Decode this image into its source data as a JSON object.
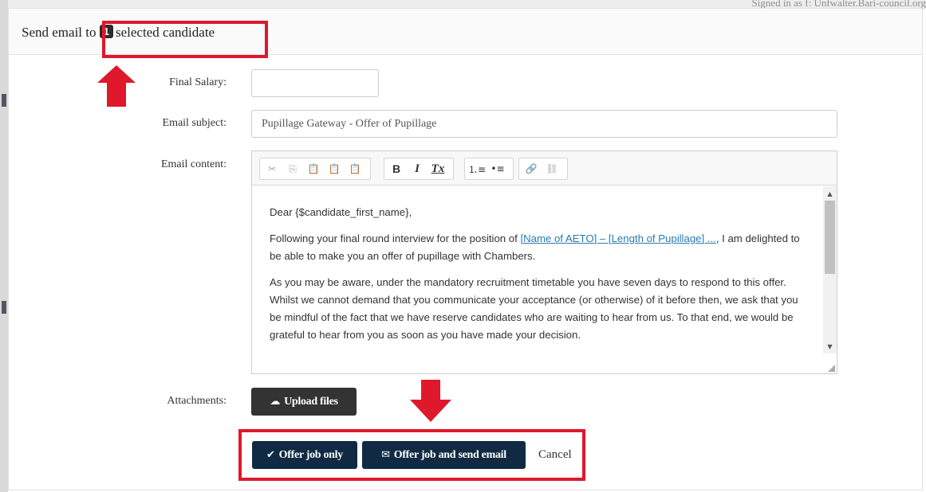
{
  "background": {
    "top_text": "Signed in as f: Unfwalter.Bari-council.org"
  },
  "modal": {
    "title_prefix": "Send email to",
    "selected_count": "1",
    "title_suffix": "selected candidate"
  },
  "form": {
    "final_salary": {
      "label": "Final Salary:",
      "value": ""
    },
    "email_subject": {
      "label": "Email subject:",
      "value": "Pupillage Gateway - Offer of Pupillage"
    },
    "email_content": {
      "label": "Email content:",
      "toolbar": {
        "clipboard": [
          "cut-icon",
          "copy-icon",
          "paste-icon",
          "paste-text-icon",
          "paste-word-icon"
        ],
        "basic": [
          "B",
          "I",
          "Tx"
        ],
        "lists": [
          "numbered-list-icon",
          "bulleted-list-icon"
        ],
        "links": [
          "link-icon",
          "unlink-icon"
        ]
      },
      "greeting": "Dear {$candidate_first_name},",
      "para1_before": "Following your final round interview for the position of ",
      "para1_link": "[Name of AETO] – [Length of Pupillage] ...",
      "para1_after": ", I am delighted to be able to make you an offer of pupillage with Chambers.",
      "para2": "As you may be aware, under the mandatory recruitment timetable you have seven days to respond to this offer. Whilst we cannot demand that you communicate your acceptance (or otherwise) of it before then, we ask that you be mindful of the fact that we have reserve candidates who are waiting to hear from us. To that end, we would be grateful to hear from you as soon as you have made your decision."
    },
    "attachments": {
      "label": "Attachments:",
      "upload_label": "Upload files"
    }
  },
  "actions": {
    "offer_only": "Offer job only",
    "offer_and_email": "Offer job and send email",
    "cancel": "Cancel"
  },
  "colors": {
    "highlight": "#e0182b",
    "primary_button": "#102a43",
    "upload_button": "#333333",
    "link": "#2a7ab3"
  }
}
